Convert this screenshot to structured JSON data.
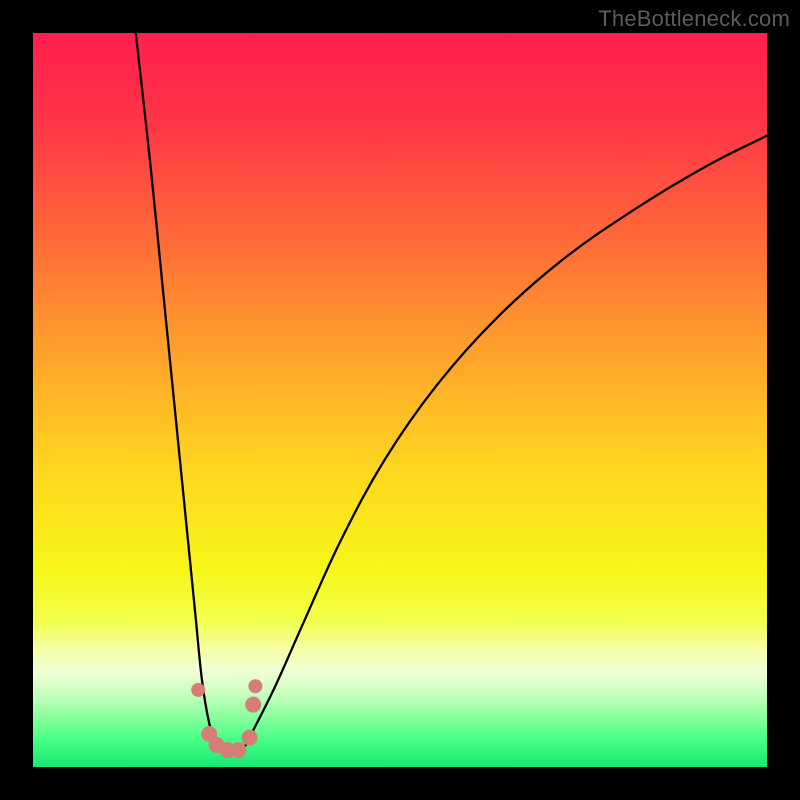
{
  "watermark": "TheBottleneck.com",
  "colors": {
    "frame": "#000000",
    "curve_stroke": "#000000",
    "marker_fill": "#d57d77",
    "gradient_stops": [
      {
        "offset": "0%",
        "color": "#ff1f4e"
      },
      {
        "offset": "12%",
        "color": "#ff3447"
      },
      {
        "offset": "28%",
        "color": "#ff6a38"
      },
      {
        "offset": "45%",
        "color": "#ffa72a"
      },
      {
        "offset": "60%",
        "color": "#ffd81f"
      },
      {
        "offset": "73%",
        "color": "#f7f618"
      },
      {
        "offset": "80%",
        "color": "#f2ff4c"
      },
      {
        "offset": "84%",
        "color": "#f6ffa8"
      },
      {
        "offset": "87%",
        "color": "#f1ffd6"
      },
      {
        "offset": "90%",
        "color": "#c8ffbf"
      },
      {
        "offset": "93%",
        "color": "#8dffa0"
      },
      {
        "offset": "96%",
        "color": "#4cff87"
      },
      {
        "offset": "100%",
        "color": "#17e873"
      }
    ]
  },
  "chart_data": {
    "type": "line",
    "title": "",
    "xlabel": "",
    "ylabel": "",
    "x_range": [
      0,
      100
    ],
    "y_range": [
      0,
      100
    ],
    "notes": "V-shaped bottleneck curve. No numeric axis ticks or labels are shown; values are estimated from pixel geometry on a normalized 0–100 scale where y=0 is the bottom (green) and y=100 is the top (red). Minimum (optimal point) is near x≈25.",
    "series": [
      {
        "name": "left-branch",
        "x": [
          14,
          16,
          18,
          20,
          22,
          23,
          24,
          25
        ],
        "y": [
          100,
          82,
          62,
          42,
          22,
          12,
          6,
          3
        ]
      },
      {
        "name": "valley",
        "x": [
          25,
          26,
          27,
          28,
          29,
          30
        ],
        "y": [
          3,
          2,
          2,
          2,
          3,
          5
        ]
      },
      {
        "name": "right-branch",
        "x": [
          30,
          33,
          37,
          42,
          48,
          55,
          63,
          72,
          82,
          92,
          100
        ],
        "y": [
          5,
          11,
          20,
          31,
          42,
          52,
          61,
          69,
          76,
          82,
          86
        ]
      }
    ],
    "markers": {
      "name": "scatter-points",
      "x": [
        22.5,
        24.0,
        25.0,
        26.5,
        28.0,
        29.5,
        30.0,
        30.3
      ],
      "y": [
        10.5,
        4.5,
        3.0,
        2.3,
        2.3,
        4.0,
        8.5,
        11.0
      ]
    }
  }
}
